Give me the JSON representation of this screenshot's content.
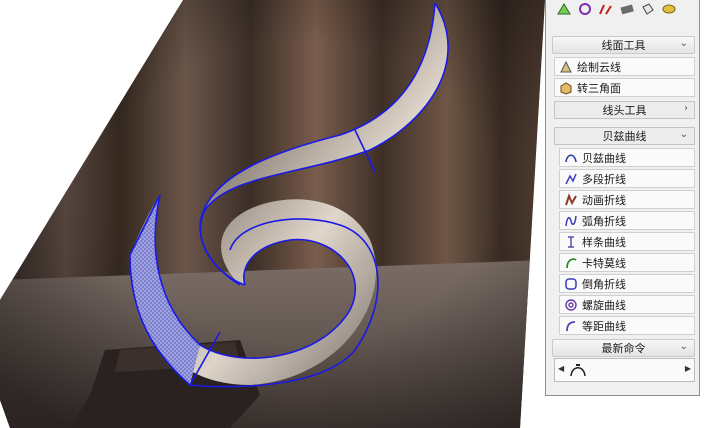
{
  "panel": {
    "icons": [
      "rectangle-tool-icon",
      "circle-tool-icon",
      "pencil-edit-icon",
      "eraser-tool-icon",
      "paint-bucket-icon",
      "tape-measure-icon"
    ],
    "sections": {
      "line_face": {
        "title": "线面工具",
        "items": [
          {
            "label": "绘制云线",
            "icon": "cloud-line-icon"
          },
          {
            "label": "转三角面",
            "icon": "triangulate-face-icon"
          }
        ],
        "sub": {
          "title": "线头工具"
        }
      },
      "bezier": {
        "title": "贝兹曲线",
        "items": [
          {
            "label": "贝兹曲线",
            "icon": "bezier-curve-icon"
          },
          {
            "label": "多段折线",
            "icon": "polyline-icon"
          },
          {
            "label": "动画折线",
            "icon": "animated-polyline-icon"
          },
          {
            "label": "弧角折线",
            "icon": "arc-polyline-icon"
          },
          {
            "label": "样条曲线",
            "icon": "spline-icon"
          },
          {
            "label": "卡特莫线",
            "icon": "catmull-rom-icon"
          },
          {
            "label": "倒角折线",
            "icon": "chamfer-polyline-icon"
          },
          {
            "label": "螺旋曲线",
            "icon": "spiral-curve-icon"
          },
          {
            "label": "等距曲线",
            "icon": "offset-curve-icon"
          }
        ]
      },
      "recent": {
        "title": "最新命令",
        "items": [
          "bezier-curve-icon"
        ]
      }
    }
  }
}
